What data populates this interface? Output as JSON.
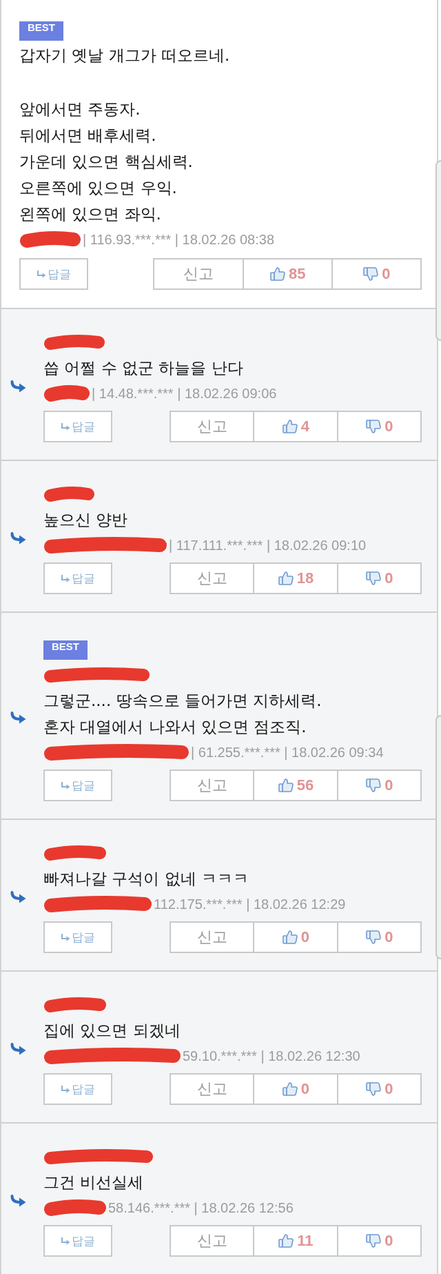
{
  "comments": [
    {
      "kind": "comment",
      "badge": "BEST",
      "body": [
        "갑자기 옛날 개그가 떠오르네.",
        "앞에서면 주동자.\n뒤에서면 배후세력.\n가운데 있으면 핵심세력.\n오른쪽에 있으면 우익.\n왼쪽에 있으면 좌익."
      ],
      "meta": "| 116.93.***.*** | 18.02.26 08:38",
      "reply_button": "답글",
      "report_button": "신고",
      "likes": "85",
      "dislikes": "0"
    },
    {
      "kind": "reply",
      "body": [
        "씁 어쩔 수 없군 하늘을 난다"
      ],
      "meta": "| 14.48.***.*** | 18.02.26 09:06",
      "reply_button": "답글",
      "report_button": "신고",
      "likes": "4",
      "dislikes": "0"
    },
    {
      "kind": "reply",
      "body": [
        "높으신 양반"
      ],
      "meta": "| 117.111.***.*** | 18.02.26 09:10",
      "reply_button": "답글",
      "report_button": "신고",
      "likes": "18",
      "dislikes": "0"
    },
    {
      "kind": "reply",
      "badge": "BEST",
      "body": [
        "그렇군.... 땅속으로 들어가면 지하세력.\n혼자 대열에서 나와서 있으면 점조직."
      ],
      "meta": "| 61.255.***.*** | 18.02.26 09:34",
      "reply_button": "답글",
      "report_button": "신고",
      "likes": "56",
      "dislikes": "0"
    },
    {
      "kind": "reply",
      "body": [
        "빠져나갈 구석이 없네 ㅋㅋㅋ"
      ],
      "meta": "112.175.***.*** | 18.02.26 12:29",
      "reply_button": "답글",
      "report_button": "신고",
      "likes": "0",
      "dislikes": "0"
    },
    {
      "kind": "reply",
      "body": [
        "집에 있으면 되겠네"
      ],
      "meta": "59.10.***.*** | 18.02.26 12:30",
      "reply_button": "답글",
      "report_button": "신고",
      "likes": "0",
      "dislikes": "0"
    },
    {
      "kind": "reply",
      "body": [
        "그건 비선실세"
      ],
      "meta": "58.146.***.*** | 18.02.26 12:56",
      "reply_button": "답글",
      "report_button": "신고",
      "likes": "11",
      "dislikes": "0"
    }
  ]
}
